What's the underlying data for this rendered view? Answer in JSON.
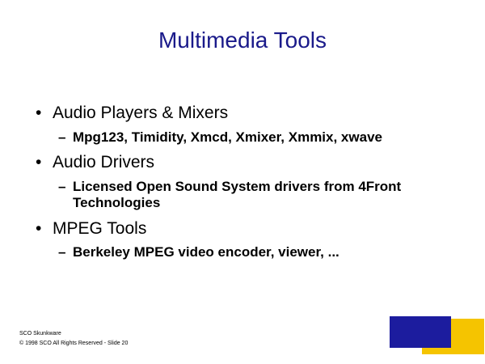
{
  "slide": {
    "title": "Multimedia Tools",
    "bullets": [
      {
        "text": "Audio Players & Mixers",
        "subs": [
          "Mpg123, Timidity, Xmcd, Xmixer, Xmmix, xwave"
        ]
      },
      {
        "text": "Audio Drivers",
        "subs": [
          "Licensed Open Sound System drivers from 4Front Technologies"
        ]
      },
      {
        "text": "MPEG Tools",
        "subs": [
          "Berkeley MPEG video encoder, viewer, ..."
        ]
      }
    ],
    "bullet_symbol": "•",
    "dash_symbol": "–",
    "footer": {
      "line1": "SCO Skunkware",
      "line2": "© 1998 SCO   All Rights Reserved - Slide 20"
    },
    "colors": {
      "title": "#1a1a8a",
      "accent_blue": "#1c1c9e",
      "accent_yellow": "#f5c400"
    }
  }
}
